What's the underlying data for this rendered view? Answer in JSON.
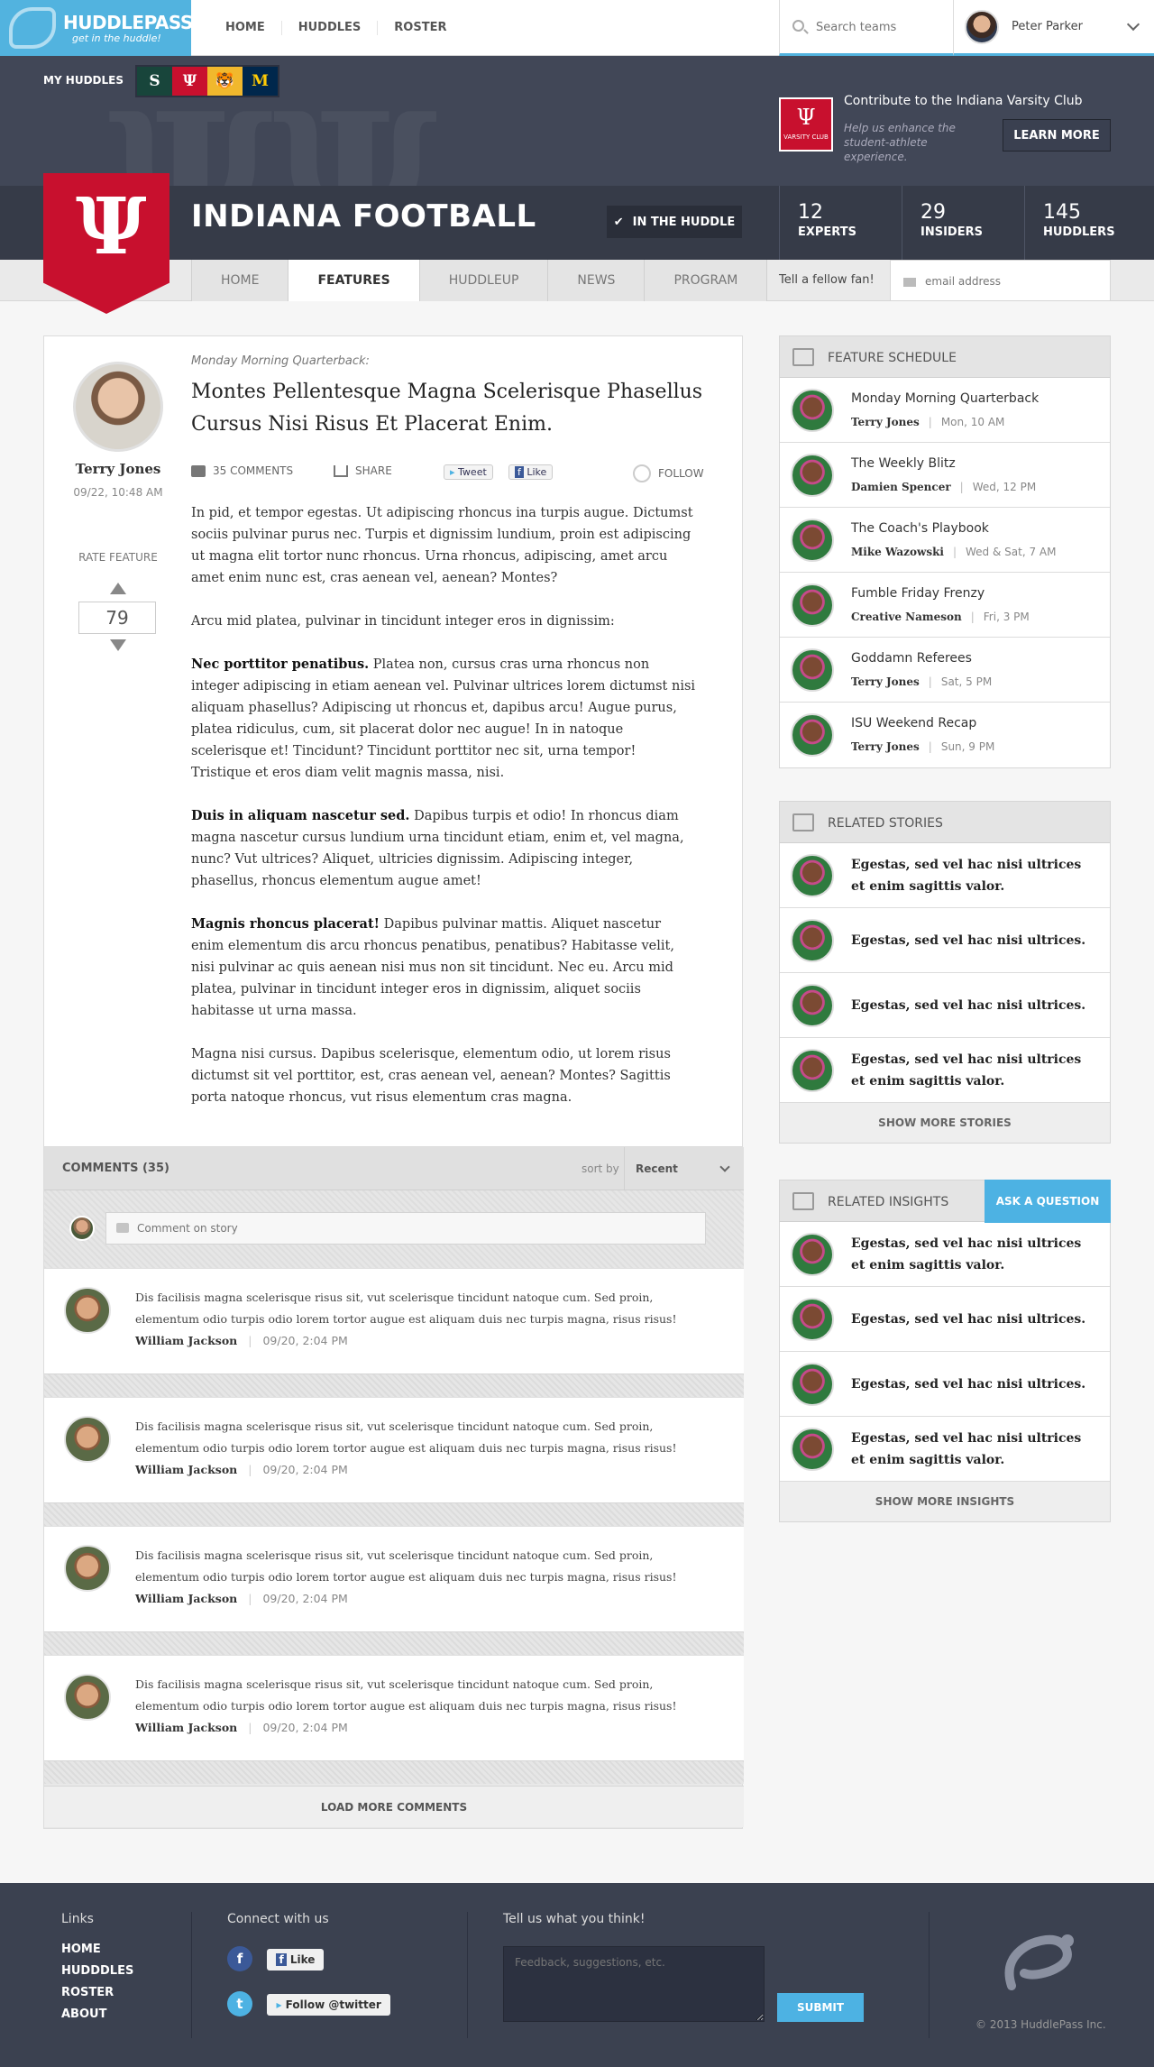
{
  "brand": {
    "name": "HUDDLEPASS",
    "tagline": "get in the huddle!"
  },
  "nav": {
    "items": [
      "HOME",
      "HUDDLES",
      "ROSTER"
    ]
  },
  "search": {
    "placeholder": "Search teams"
  },
  "user": {
    "name": "Peter Parker"
  },
  "my_huddles": {
    "label": "MY HUDDLES",
    "teams": [
      {
        "glyph": "S",
        "color": "#18453b",
        "fg": "#fff"
      },
      {
        "glyph": "Ψ",
        "color": "#c8102e",
        "fg": "#fff"
      },
      {
        "glyph": "🐯",
        "color": "#f1b82d",
        "fg": "#000"
      },
      {
        "glyph": "M",
        "color": "#00274c",
        "fg": "#ffcb05"
      }
    ]
  },
  "varsity": {
    "badge": "VARSITY CLUB",
    "title": "Contribute to the Indiana Varsity Club",
    "text": "Help us enhance the student-athlete experience.",
    "button": "LEARN MORE"
  },
  "team": {
    "name": "INDIANA FOOTBALL",
    "huddle_button": "IN THE HUDDLE",
    "stats": [
      {
        "value": "12",
        "label": "EXPERTS"
      },
      {
        "value": "29",
        "label": "INSIDERS"
      },
      {
        "value": "145",
        "label": "HUDDLERS"
      }
    ]
  },
  "subnav": {
    "tabs": [
      "HOME",
      "FEATURES",
      "HUDDLEUP",
      "NEWS",
      "PROGRAM"
    ],
    "active": "FEATURES"
  },
  "fellow": {
    "label": "Tell a fellow fan!",
    "placeholder": "email address"
  },
  "article": {
    "author": "Terry Jones",
    "date": "09/22, 10:48 AM",
    "rate_label": "RATE FEATURE",
    "rating": "79",
    "kicker": "Monday Morning Quarterback:",
    "headline": "Montes Pellentesque Magna Scelerisque Phasellus Cursus Nisi Risus Et Placerat Enim.",
    "comments_count": "35 COMMENTS",
    "share": "SHARE",
    "tweet": "Tweet",
    "like": "Like",
    "follow": "FOLLOW",
    "paragraphs": [
      {
        "lead": "",
        "text": "In pid, et tempor egestas. Ut adipiscing rhoncus ina turpis augue. Dictumst sociis pulvinar purus nec. Turpis et dignissim lundium, proin est adipiscing ut magna elit tortor nunc rhoncus. Urna rhoncus, adipiscing, amet arcu amet enim nunc est, cras aenean vel, aenean? Montes?"
      },
      {
        "lead": "",
        "text": "Arcu mid platea, pulvinar in tincidunt integer eros in dignissim:"
      },
      {
        "lead": "Nec porttitor penatibus.",
        "text": " Platea non, cursus cras urna rhoncus non integer adipiscing in etiam aenean vel. Pulvinar ultrices lorem dictumst nisi aliquam phasellus? Adipiscing ut rhoncus et, dapibus arcu! Augue purus, platea ridiculus, cum, sit placerat dolor nec augue! In in natoque scelerisque et! Tincidunt? Tincidunt porttitor nec sit, urna tempor! Tristique et eros diam velit magnis massa, nisi."
      },
      {
        "lead": "Duis in aliquam nascetur sed.",
        "text": " Dapibus turpis et odio! In rhoncus diam magna nascetur cursus lundium urna tincidunt etiam, enim et, vel magna, nunc? Vut ultrices? Aliquet, ultricies dignissim. Adipiscing integer, phasellus, rhoncus elementum augue amet!"
      },
      {
        "lead": "Magnis rhoncus placerat!",
        "text": " Dapibus pulvinar mattis. Aliquet nascetur enim elementum dis arcu rhoncus penatibus, penatibus? Habitasse velit, nisi pulvinar ac quis aenean nisi mus non sit tincidunt. Nec eu. Arcu mid platea, pulvinar in tincidunt integer eros in dignissim, aliquet sociis habitasse ut urna massa."
      },
      {
        "lead": "",
        "text": "Magna nisi cursus. Dapibus scelerisque, elementum odio, ut lorem risus dictumst sit vel porttitor, est, cras aenean vel, aenean? Montes? Sagittis porta natoque rhoncus, vut risus elementum cras magna."
      }
    ]
  },
  "comments": {
    "title": "COMMENTS (35)",
    "sort_label": "sort by",
    "sort_value": "Recent",
    "placeholder": "Comment on story",
    "items": [
      {
        "text": "Dis facilisis magna scelerisque risus sit, vut scelerisque tincidunt natoque cum. Sed proin, elementum odio turpis odio lorem tortor augue est aliquam duis nec turpis magna, risus risus!",
        "author": "William Jackson",
        "date": "09/20, 2:04 PM"
      },
      {
        "text": "Dis facilisis magna scelerisque risus sit, vut scelerisque tincidunt natoque cum. Sed proin, elementum odio turpis odio lorem tortor augue est aliquam duis nec turpis magna, risus risus!",
        "author": "William Jackson",
        "date": "09/20, 2:04 PM"
      },
      {
        "text": "Dis facilisis magna scelerisque risus sit, vut scelerisque tincidunt natoque cum. Sed proin, elementum odio turpis odio lorem tortor augue est aliquam duis nec turpis magna, risus risus!",
        "author": "William Jackson",
        "date": "09/20, 2:04 PM"
      },
      {
        "text": "Dis facilisis magna scelerisque risus sit, vut scelerisque tincidunt natoque cum. Sed proin, elementum odio turpis odio lorem tortor augue est aliquam duis nec turpis magna, risus risus!",
        "author": "William Jackson",
        "date": "09/20, 2:04 PM"
      }
    ],
    "load_more": "LOAD MORE COMMENTS"
  },
  "schedule": {
    "title": "FEATURE SCHEDULE",
    "items": [
      {
        "title": "Monday Morning Quarterback",
        "author": "Terry Jones",
        "when": "Mon, 10 AM"
      },
      {
        "title": "The Weekly Blitz",
        "author": "Damien Spencer",
        "when": "Wed, 12 PM"
      },
      {
        "title": "The Coach's Playbook",
        "author": "Mike Wazowski",
        "when": "Wed & Sat, 7 AM"
      },
      {
        "title": "Fumble Friday Frenzy",
        "author": "Creative Nameson",
        "when": "Fri, 3 PM"
      },
      {
        "title": "Goddamn Referees",
        "author": "Terry Jones",
        "when": "Sat, 5 PM"
      },
      {
        "title": "ISU Weekend Recap",
        "author": "Terry Jones",
        "when": "Sun, 9 PM"
      }
    ]
  },
  "related_stories": {
    "title": "RELATED STORIES",
    "items": [
      "Egestas, sed vel hac nisi ultrices et enim sagittis valor.",
      "Egestas, sed vel hac nisi ultrices.",
      "Egestas, sed vel hac nisi ultrices.",
      "Egestas, sed vel hac nisi ultrices et enim sagittis valor."
    ],
    "more": "SHOW MORE STORIES"
  },
  "related_insights": {
    "title": "RELATED INSIGHTS",
    "ask": "ASK A QUESTION",
    "items": [
      "Egestas, sed vel hac nisi ultrices et enim sagittis valor.",
      "Egestas, sed vel hac nisi ultrices.",
      "Egestas, sed vel hac nisi ultrices.",
      "Egestas, sed vel hac nisi ultrices et enim sagittis valor."
    ],
    "more": "SHOW MORE INSIGHTS"
  },
  "footer": {
    "links_title": "Links",
    "links": [
      "HOME",
      "HUDDDLES",
      "ROSTER",
      "ABOUT"
    ],
    "connect_title": "Connect with us",
    "fb_like": "Like",
    "twitter_follow": "Follow @twitter",
    "feedback_title": "Tell us what you think!",
    "feedback_placeholder": "Feedback, suggestions, etc.",
    "submit": "SUBMIT",
    "copyright": "© 2013 HuddlePass Inc."
  }
}
